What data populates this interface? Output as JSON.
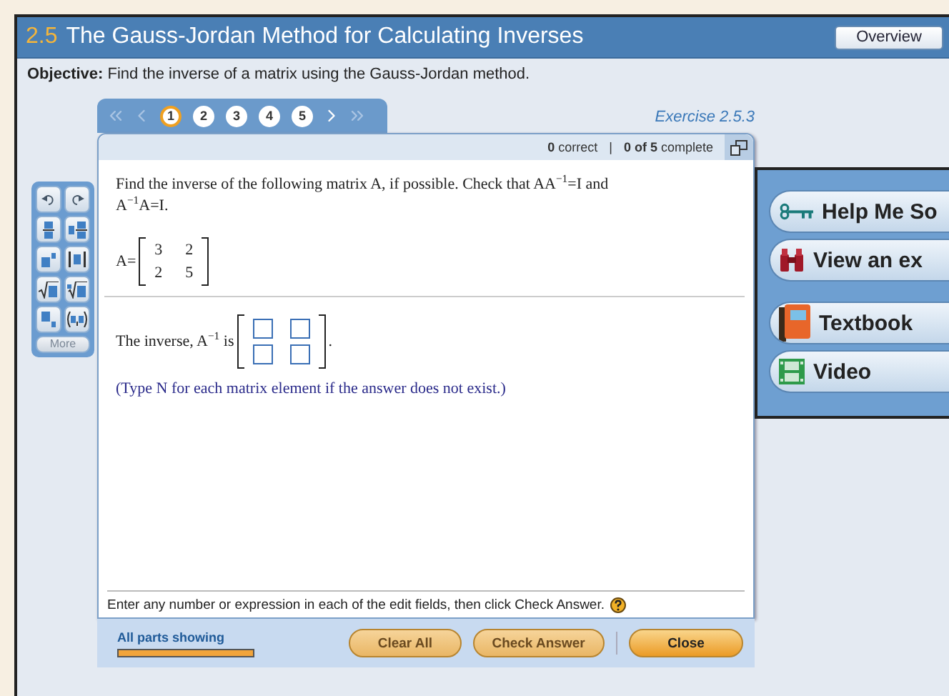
{
  "header": {
    "section": "2.5",
    "title": "The Gauss-Jordan Method for Calculating Inverses",
    "overview_button": "Overview"
  },
  "objective": {
    "label": "Objective:",
    "text": "Find the inverse of a matrix using the Gauss-Jordan method."
  },
  "question_nav": {
    "pages": [
      {
        "label": "1",
        "selected": true
      },
      {
        "label": "2",
        "selected": false
      },
      {
        "label": "3",
        "selected": false
      },
      {
        "label": "4",
        "selected": false
      },
      {
        "label": "5",
        "selected": false
      }
    ],
    "exercise": "Exercise 2.5.3"
  },
  "status": {
    "correct": "**0** correct",
    "separator": "|",
    "complete": "**0 of 5** complete"
  },
  "palette": {
    "buttons": [
      {
        "kind": "undo"
      },
      {
        "kind": "redo"
      },
      {
        "kind": "fraction"
      },
      {
        "kind": "mixed"
      },
      {
        "kind": "exponent"
      },
      {
        "kind": "absolute"
      },
      {
        "kind": "sqrt"
      },
      {
        "kind": "nthroot"
      },
      {
        "kind": "subscript"
      },
      {
        "kind": "pair"
      }
    ],
    "more": "More"
  },
  "question": {
    "prompt": "Find the inverse of the following matrix A, if possible. Check that AA$^{−1}$=I and A$^{−1}$A=I.",
    "matrix_label": "A=",
    "matrix": [
      [
        "3",
        "2"
      ],
      [
        "2",
        "5"
      ]
    ],
    "answer_label": "The inverse, A$^{−1}$ is",
    "answer_end": ".",
    "answer_cells": [
      [
        "",
        ""
      ],
      [
        "",
        ""
      ]
    ],
    "hint": "(Type N for each matrix element if the answer does not exist.)"
  },
  "instruction": "Enter any number or expression in each of the edit fields, then click Check Answer.",
  "footer": {
    "parts": "All parts showing",
    "level": 1,
    "buttons": [
      "Clear All",
      "Check Answer"
    ],
    "close": "Close"
  },
  "help_panel": [
    {
      "kind": "key",
      "label": "Help Me So"
    },
    {
      "kind": "binoculars",
      "label": "View an ex"
    },
    {
      "kind": "book",
      "label": "Textbook"
    },
    {
      "kind": "film",
      "label": "Video"
    }
  ]
}
